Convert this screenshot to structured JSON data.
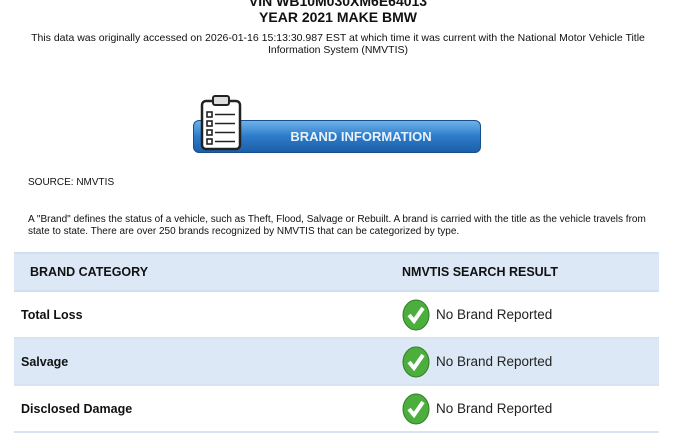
{
  "header": {
    "vin": "VIN WB10M030XM6E64013",
    "year_make": "YEAR 2021 MAKE BMW",
    "disclaimer": "This data was originally accessed on 2026-01-16 15:13:30.987 EST at which time it was current with the National Motor Vehicle Title Information System (NMVTIS)"
  },
  "button": {
    "label": "BRAND INFORMATION"
  },
  "source": "SOURCE: NMVTIS",
  "description": "A \"Brand\" defines the status of a vehicle, such as Theft, Flood, Salvage or Rebuilt. A brand is carried with the title as the vehicle travels from state to state. There are over 250 brands recognized by NMVTIS that can be categorized by type.",
  "table": {
    "headers": [
      "BRAND CATEGORY",
      "NMVTIS SEARCH RESULT"
    ],
    "rows": [
      {
        "category": "Total Loss",
        "result": "No Brand Reported"
      },
      {
        "category": "Salvage",
        "result": "No Brand Reported"
      },
      {
        "category": "Disclosed Damage",
        "result": "No Brand Reported"
      }
    ]
  }
}
